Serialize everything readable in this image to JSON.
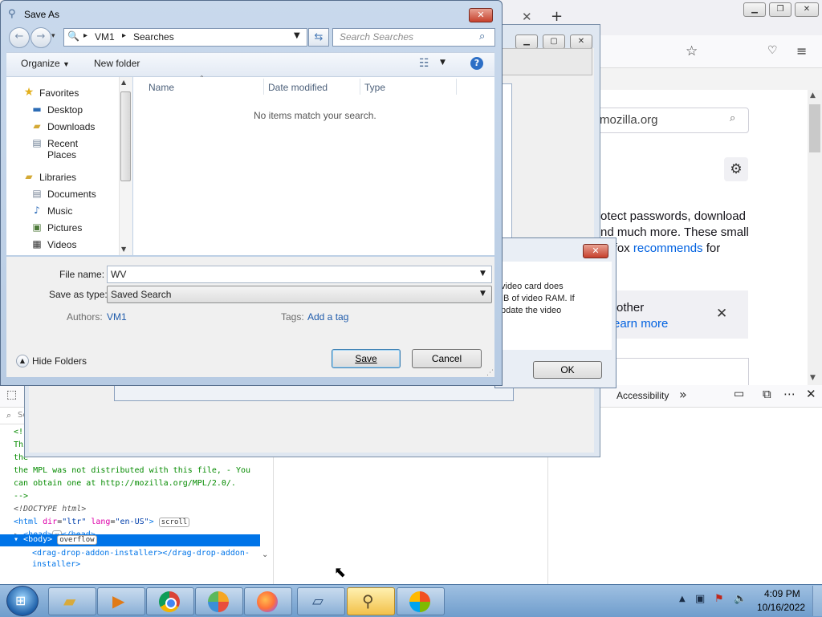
{
  "save_dialog": {
    "title": "Save As",
    "breadcrumb": [
      "VM1",
      "Searches"
    ],
    "search_placeholder": "Search Searches",
    "toolbar": {
      "organize": "Organize",
      "new_folder": "New folder"
    },
    "nav": {
      "favorites_label": "Favorites",
      "favorites": [
        "Desktop",
        "Downloads",
        "Recent Places"
      ],
      "libraries_label": "Libraries",
      "libraries": [
        "Documents",
        "Music",
        "Pictures",
        "Videos"
      ]
    },
    "columns": [
      "Name",
      "Date modified",
      "Type"
    ],
    "empty_message": "No items match your search.",
    "file_name_label": "File name:",
    "file_name_value": "WV",
    "save_type_label": "Save as type:",
    "save_type_value": "Saved Search",
    "authors_label": "Authors:",
    "authors_value": "VM1",
    "tags_label": "Tags:",
    "tags_value": "Add a tag",
    "hide_folders": "Hide Folders",
    "save_button": "Save",
    "cancel_button": "Cancel"
  },
  "message_box": {
    "lines": [
      "video card does",
      "IB of video RAM. If",
      "pdate the video"
    ],
    "ok_button": "OK"
  },
  "firefox": {
    "search_text": "mozilla.org",
    "para_lines": [
      "otect passwords, download",
      "nd much more. These small",
      "irefox"
    ],
    "link": "recommends",
    "para_tail": "for",
    "card_line1": "other",
    "card_link": "earn more"
  },
  "devtools": {
    "accessibility_tab": "Accessibility",
    "search_glyph": "Se",
    "code": {
      "c1": "<!-",
      "c2": "Thi",
      "c3": "the",
      "c4": "the MPL was not distributed with this file, - You",
      "c5": "can obtain one at http://mozilla.org/MPL/2.0/.",
      "c6": "-->",
      "doctype": "<!DOCTYPE html>",
      "html_open": "<html",
      "html_attr1": "dir",
      "html_val1": "\"ltr\"",
      "html_attr2": "lang",
      "html_val2": "\"en-US\"",
      "scroll_badge": "scroll",
      "head": "<head>",
      "head_close": "</head>",
      "body": "<body>",
      "overflow_badge": "overflow",
      "drag1": "<drag-drop-addon-installer></drag-drop-addon-",
      "drag2": "installer>"
    }
  },
  "taskbar": {
    "time": "4:09 PM",
    "date": "10/16/2022"
  }
}
